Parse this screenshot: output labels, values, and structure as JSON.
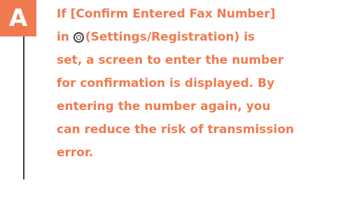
{
  "badge": {
    "letter": "A"
  },
  "colors": {
    "accent": "#f07a4f",
    "divider": "#3a3a3a"
  },
  "answer": {
    "line1": "If [Confirm Entered Fax Number]",
    "line2_prefix": "in",
    "line2_icon": "settings-registration-icon",
    "line2_suffix": "(Settings/Registration) is",
    "line3": "set, a screen to enter the number",
    "line4": "for confirmation is displayed. By",
    "line5": "entering the number again, you",
    "line6": "can reduce the risk of transmission",
    "line7": "error."
  }
}
